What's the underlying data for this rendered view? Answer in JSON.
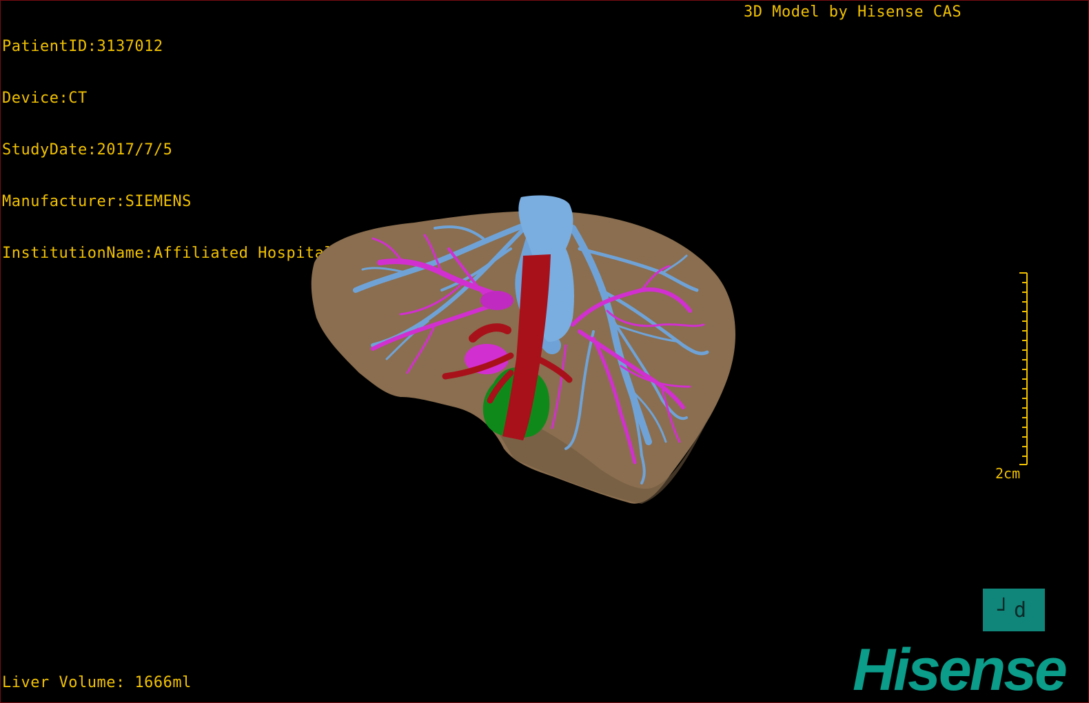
{
  "patient_info": {
    "patient_id": "PatientID:3137012",
    "device": "Device:CT",
    "study_date": "StudyDate:2017/7/5",
    "manufacturer": "Manufacturer:SIEMENS",
    "institution": "InstitutionName:Affiliated Hospital Qingdao University-C"
  },
  "credit": "3D Model by Hisense CAS",
  "scale_label": "2cm",
  "liver_volume": "Liver Volume: 1666ml",
  "orientation_label": "┘d",
  "brand": "Hisense",
  "colors": {
    "text": "#f2c200",
    "liver": "#8a6e4f",
    "hepatic_vein": "#6fa3d8",
    "portal_vein": "#d22fd0",
    "vena_cava": "#a8111a",
    "gallbladder": "#0f8a1a",
    "brand": "#0b9c8a",
    "border": "#7a0d12"
  },
  "icons": {
    "orientation": "orientation-cube-icon",
    "model": "liver-model-icon"
  }
}
